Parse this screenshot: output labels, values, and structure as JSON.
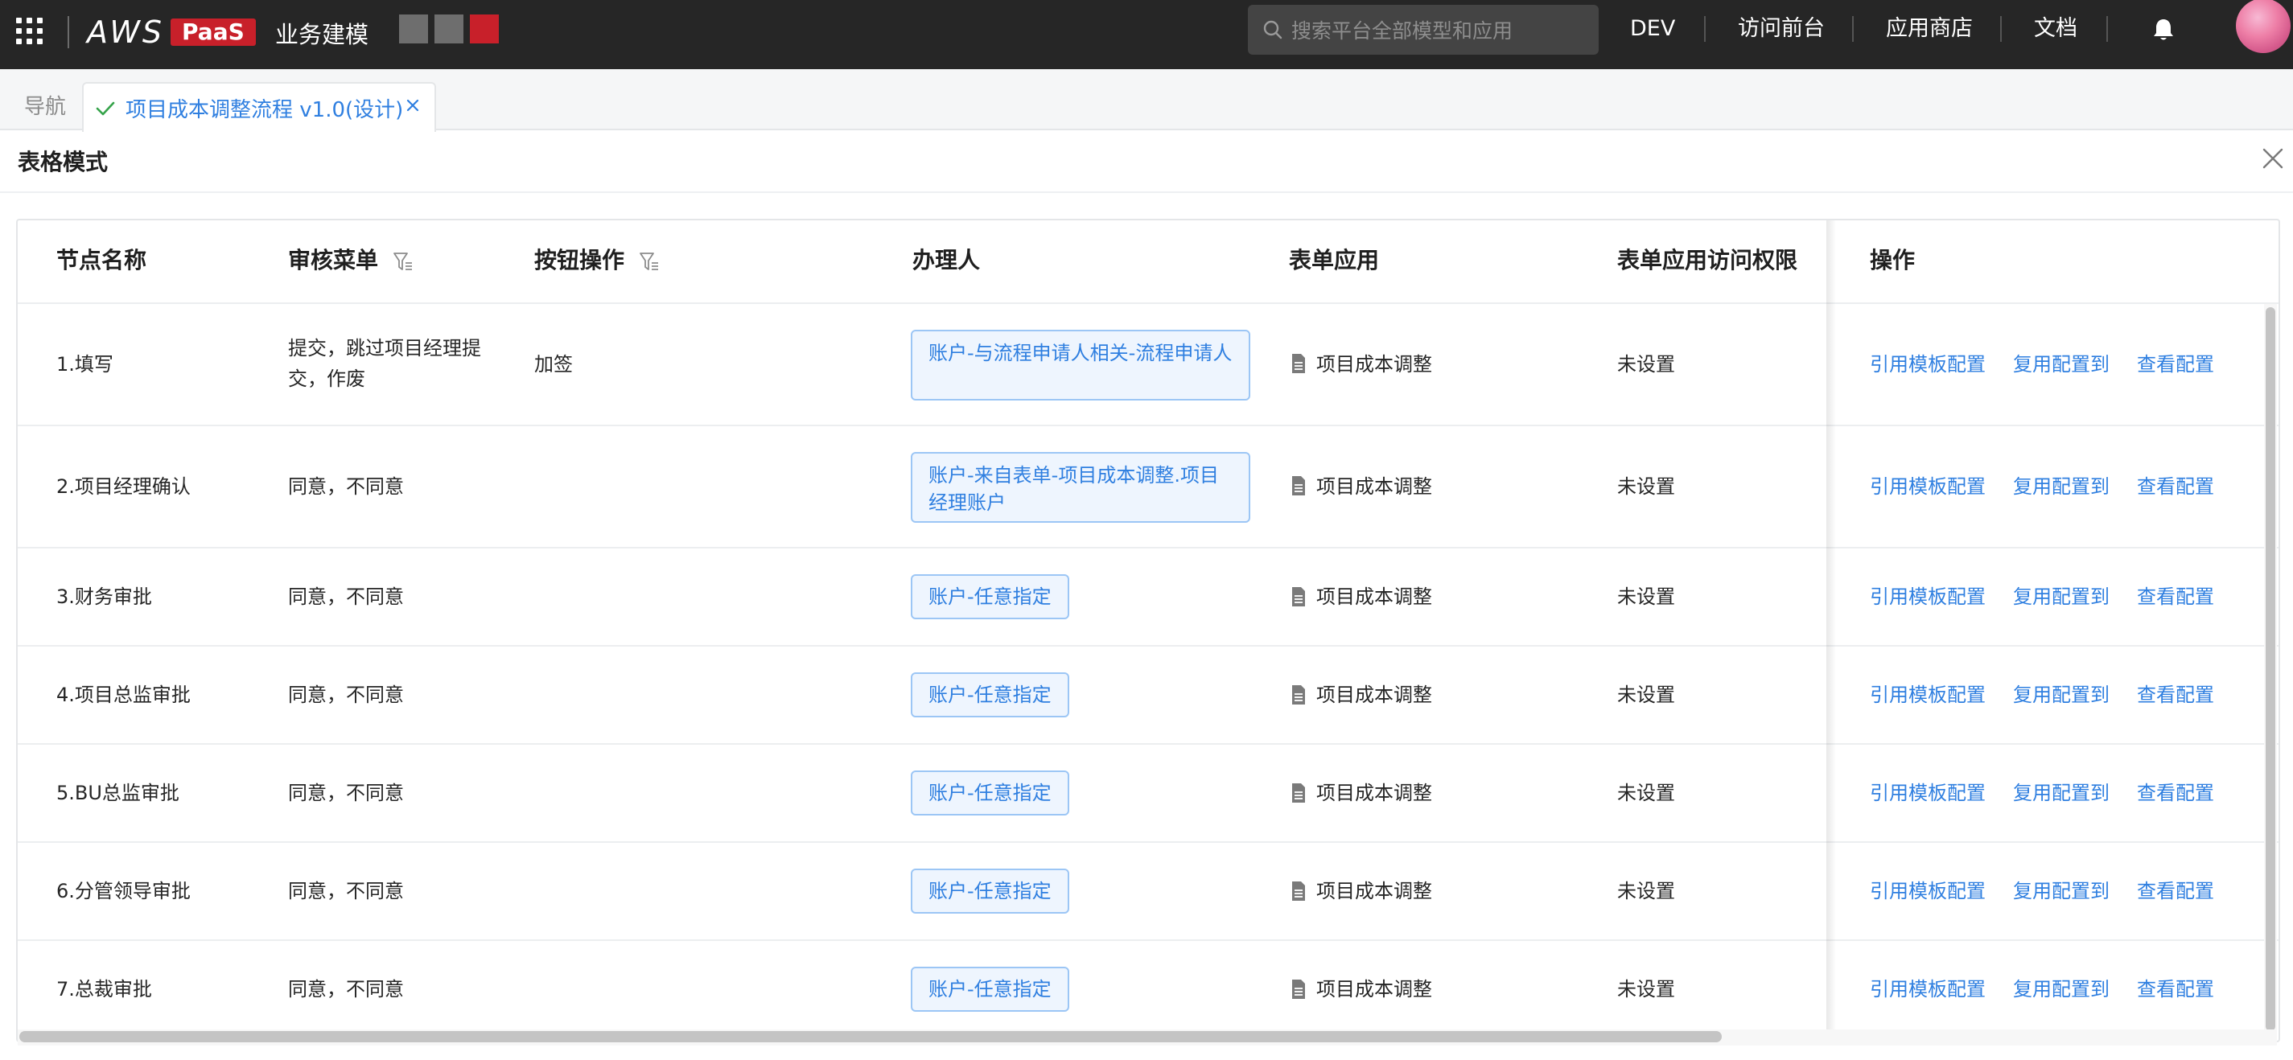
{
  "header": {
    "logo_aws": "AWS",
    "logo_paas": "PaaS",
    "app_title": "业务建模",
    "search_placeholder": "搜索平台全部模型和应用",
    "nav_links": [
      "DEV",
      "访问前台",
      "应用商店",
      "文档"
    ],
    "icons": [
      "apps-grid-icon",
      "search-icon",
      "bell-icon",
      "avatar"
    ],
    "colors": {
      "bar_bg": "#262626",
      "paas_red": "#c8202a",
      "square_gray": "#6e6e6e",
      "square_red": "#c8202a"
    }
  },
  "tabs": {
    "nav_label": "导航",
    "active_label": "项目成本调整流程 v1.0(设计)",
    "active_color": "#2f7fe0"
  },
  "page": {
    "title": "表格模式"
  },
  "table": {
    "columns": [
      "节点名称",
      "审核菜单",
      "按钮操作",
      "办理人",
      "表单应用",
      "表单应用访问权限",
      "操作"
    ],
    "actions": [
      "引用模板配置",
      "复用配置到",
      "查看配置"
    ],
    "rows": [
      {
        "name": "1.填写",
        "menu": "提交，跳过项目经理提交，作废",
        "buttons": "加签",
        "handler": "账户-与流程申请人相关-流程申请人",
        "form": "项目成本调整",
        "access": "未设置"
      },
      {
        "name": "2.项目经理确认",
        "menu": "同意，不同意",
        "buttons": "",
        "handler": "账户-来自表单-项目成本调整.项目经理账户",
        "form": "项目成本调整",
        "access": "未设置"
      },
      {
        "name": "3.财务审批",
        "menu": "同意，不同意",
        "buttons": "",
        "handler": "账户-任意指定",
        "form": "项目成本调整",
        "access": "未设置"
      },
      {
        "name": "4.项目总监审批",
        "menu": "同意，不同意",
        "buttons": "",
        "handler": "账户-任意指定",
        "form": "项目成本调整",
        "access": "未设置"
      },
      {
        "name": "5.BU总监审批",
        "menu": "同意，不同意",
        "buttons": "",
        "handler": "账户-任意指定",
        "form": "项目成本调整",
        "access": "未设置"
      },
      {
        "name": "6.分管领导审批",
        "menu": "同意，不同意",
        "buttons": "",
        "handler": "账户-任意指定",
        "form": "项目成本调整",
        "access": "未设置"
      },
      {
        "name": "7.总裁审批",
        "menu": "同意，不同意",
        "buttons": "",
        "handler": "账户-任意指定",
        "form": "项目成本调整",
        "access": "未设置"
      }
    ]
  }
}
